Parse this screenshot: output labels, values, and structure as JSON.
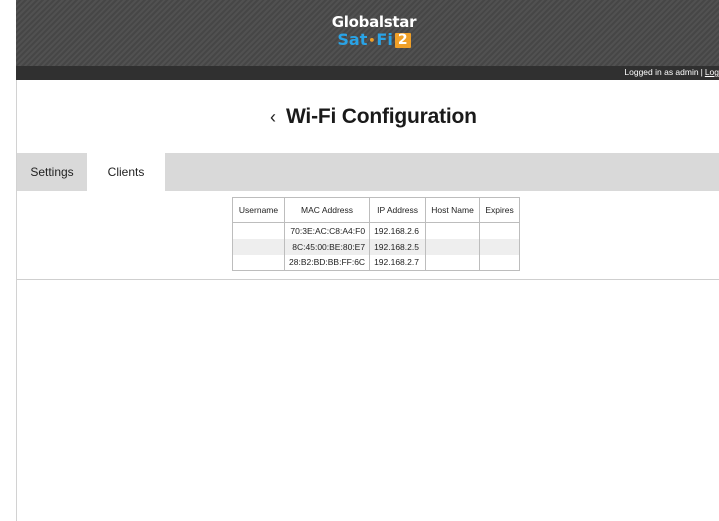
{
  "header": {
    "logo_top": "Globalstar",
    "logo_sat": "Sat",
    "logo_dot": "•",
    "logo_fi": "Fi",
    "logo_two": "2",
    "logged_in": "Logged in as admin",
    "separator": "|",
    "logout": "Log"
  },
  "page": {
    "back_glyph": "‹",
    "title": "Wi-Fi Configuration"
  },
  "tabs": [
    {
      "label": "Settings",
      "active": false
    },
    {
      "label": "Clients",
      "active": true
    }
  ],
  "clients": {
    "columns": [
      "Username",
      "MAC Address",
      "IP Address",
      "Host Name",
      "Expires"
    ],
    "rows": [
      {
        "username": "",
        "mac": "70:3E:AC:C8:A4:F0",
        "ip": "192.168.2.6",
        "host": "",
        "expires": ""
      },
      {
        "username": "",
        "mac": "8C:45:00:BE:80:E7",
        "ip": "192.168.2.5",
        "host": "",
        "expires": ""
      },
      {
        "username": "",
        "mac": "28:B2:BD:BB:FF:6C",
        "ip": "192.168.2.7",
        "host": "",
        "expires": ""
      }
    ]
  },
  "colors": {
    "header_bg": "#4a4a4a",
    "status_bar_bg": "#303030",
    "logo_blue": "#29a3e6",
    "logo_orange": "#f0a028",
    "tab_bar_bg": "#d9d9d9"
  }
}
